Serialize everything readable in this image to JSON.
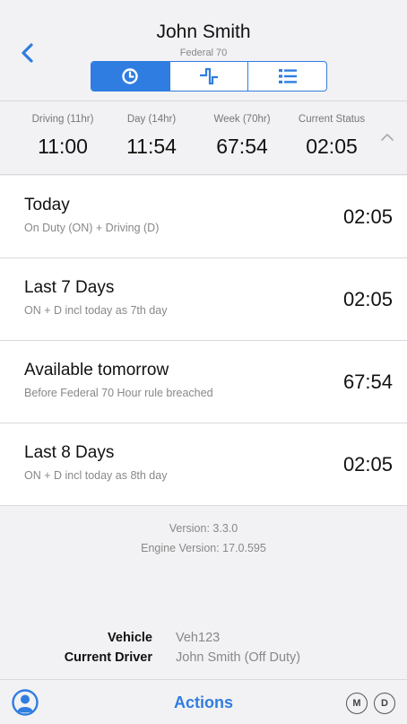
{
  "header": {
    "driver_name": "John Smith",
    "ruleset": "Federal 70",
    "back_icon": "chevron-left-icon",
    "tabs": [
      {
        "icon": "clock-icon",
        "active": true
      },
      {
        "icon": "log-graph-icon",
        "active": false
      },
      {
        "icon": "list-icon",
        "active": false
      }
    ]
  },
  "summary": {
    "driving": {
      "label": "Driving (11hr)",
      "value": "11:00"
    },
    "day": {
      "label": "Day (14hr)",
      "value": "11:54"
    },
    "week": {
      "label": "Week (70hr)",
      "value": "67:54"
    },
    "status": {
      "label": "Current Status",
      "value": "02:05"
    },
    "collapse_icon": "chevron-up-icon"
  },
  "rows": [
    {
      "title": "Today",
      "subtitle": "On Duty (ON) + Driving (D)",
      "value": "02:05"
    },
    {
      "title": "Last 7 Days",
      "subtitle": "ON + D incl today as 7th day",
      "value": "02:05"
    },
    {
      "title": "Available tomorrow",
      "subtitle": "Before Federal 70 Hour rule breached",
      "value": "67:54"
    },
    {
      "title": "Last 8 Days",
      "subtitle": "ON + D incl today as 8th day",
      "value": "02:05"
    }
  ],
  "versions": {
    "version": "Version: 3.3.0",
    "engine": "Engine Version: 17.0.595"
  },
  "vehicle_info": {
    "vehicle_label": "Vehicle",
    "vehicle_value": "Veh123",
    "driver_label": "Current Driver",
    "driver_value": "John Smith (Off Duty)"
  },
  "footer": {
    "avatar_icon": "user-avatar-icon",
    "actions_label": "Actions",
    "badge_m": "M",
    "badge_d": "D"
  },
  "colors": {
    "accent": "#2f7de1",
    "background": "#f2f2f4",
    "card": "#ffffff",
    "muted_text": "#888888"
  }
}
